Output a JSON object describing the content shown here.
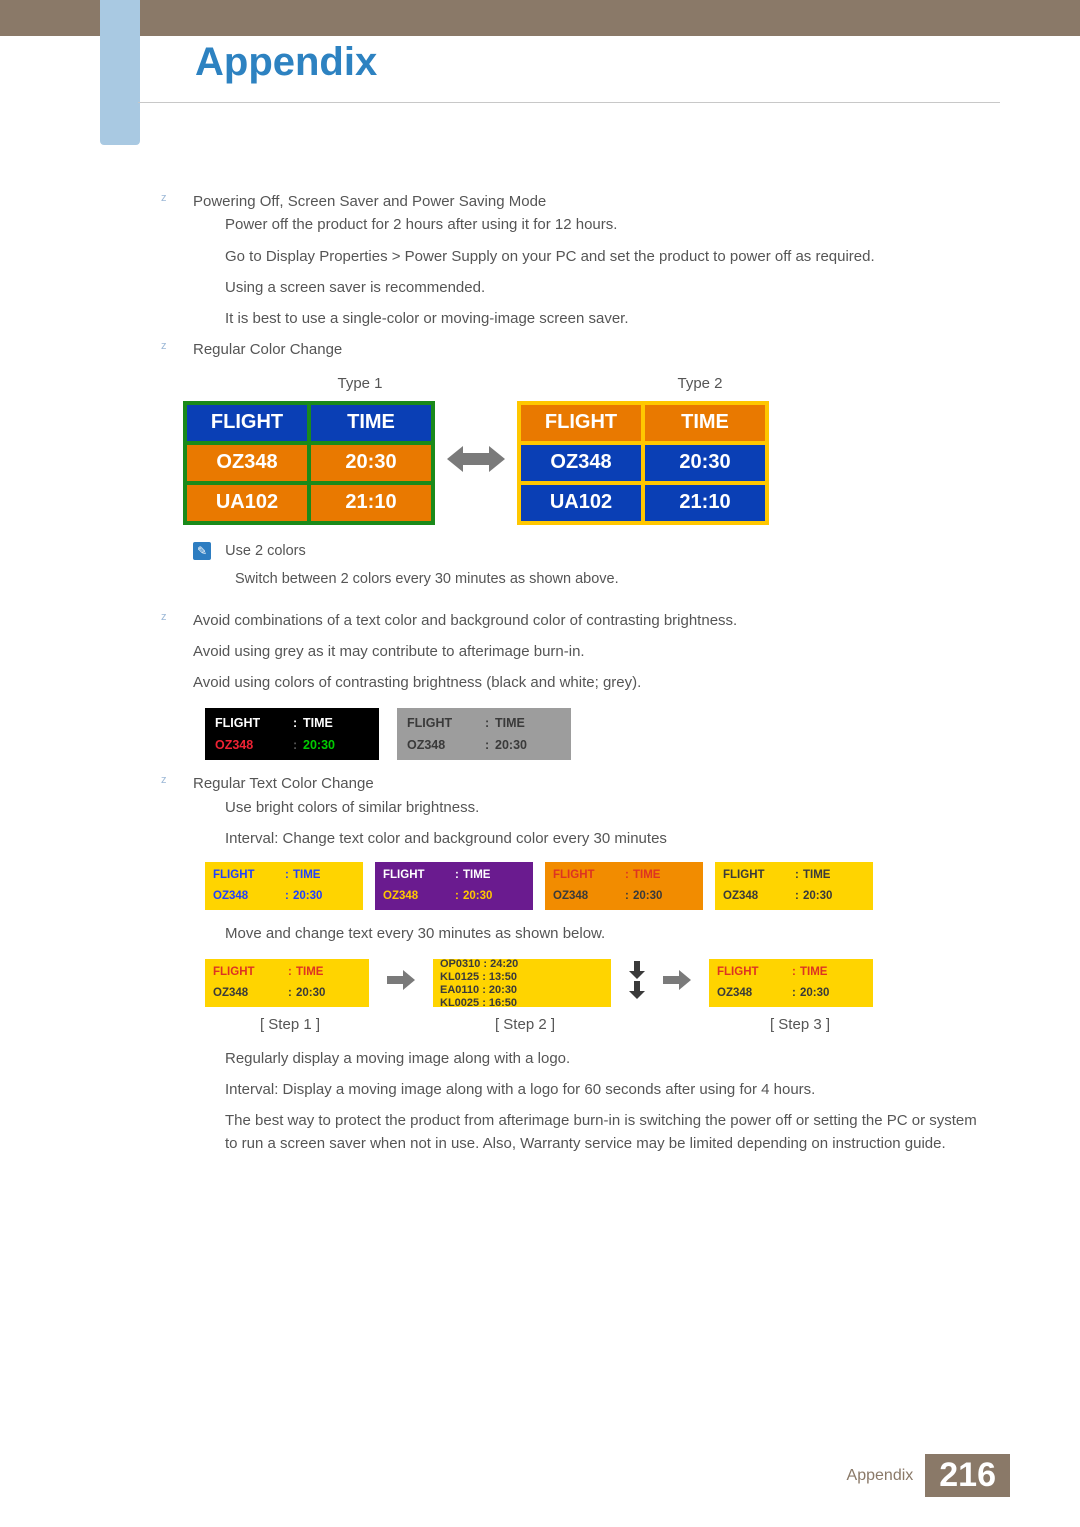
{
  "title": "Appendix",
  "sec1": {
    "heading": "Powering Off, Screen Saver and Power Saving Mode",
    "l1": "Power off the product for 2 hours after using it for 12 hours.",
    "l2": "Go to Display Properties > Power Supply on your PC and set the product to power off as required.",
    "l3": "Using a screen saver is recommended.",
    "l4": "It is best to use a single-color or moving-image screen saver."
  },
  "sec2": {
    "heading": "Regular Color Change",
    "type1": "Type 1",
    "type2": "Type 2",
    "table": {
      "h1": "FLIGHT",
      "h2": "TIME",
      "r1c1": "OZ348",
      "r1c2": "20:30",
      "r2c1": "UA102",
      "r2c2": "21:10"
    },
    "note1": "Use 2 colors",
    "note2": "Switch between 2 colors every 30 minutes as shown above."
  },
  "sec3": {
    "heading": "Avoid combinations of a text color and background color of contrasting brightness.",
    "l1": "Avoid using grey as it may contribute to afterimage burn-in.",
    "l2": "Avoid using colors of contrasting brightness (black and white; grey).",
    "mini": {
      "h1": "FLIGHT",
      "sep": ":",
      "h2": "TIME",
      "r1": "OZ348",
      "r2": "20:30"
    }
  },
  "sec4": {
    "heading": "Regular Text Color Change",
    "l1": "Use bright colors of similar brightness.",
    "l2": "Interval: Change text color and background color every 30 minutes",
    "mini": {
      "h1": "FLIGHT",
      "sep": ":",
      "h2": "TIME",
      "r1": "OZ348",
      "r2": "20:30"
    },
    "l3": "Move and change text every 30 minutes as shown below.",
    "scroll": {
      "r1": "OP0310  :  24:20",
      "r2": "KL0125  :  13:50",
      "r3": "EA0110  :  20:30",
      "r4": "KL0025  :  16:50"
    },
    "step1": "[ Step 1 ]",
    "step2": "[ Step 2 ]",
    "step3": "[ Step 3 ]",
    "l4": "Regularly display a moving image along with a logo.",
    "l5": "Interval: Display a moving image along with a logo for 60 seconds after using for 4 hours.",
    "l6": "The best way to protect the product from afterimage burn-in is switching the power off or setting the PC or system to run a screen saver when not in use. Also, Warranty service may be limited depending on instruction guide."
  },
  "footer": {
    "text": "Appendix",
    "page": "216"
  }
}
